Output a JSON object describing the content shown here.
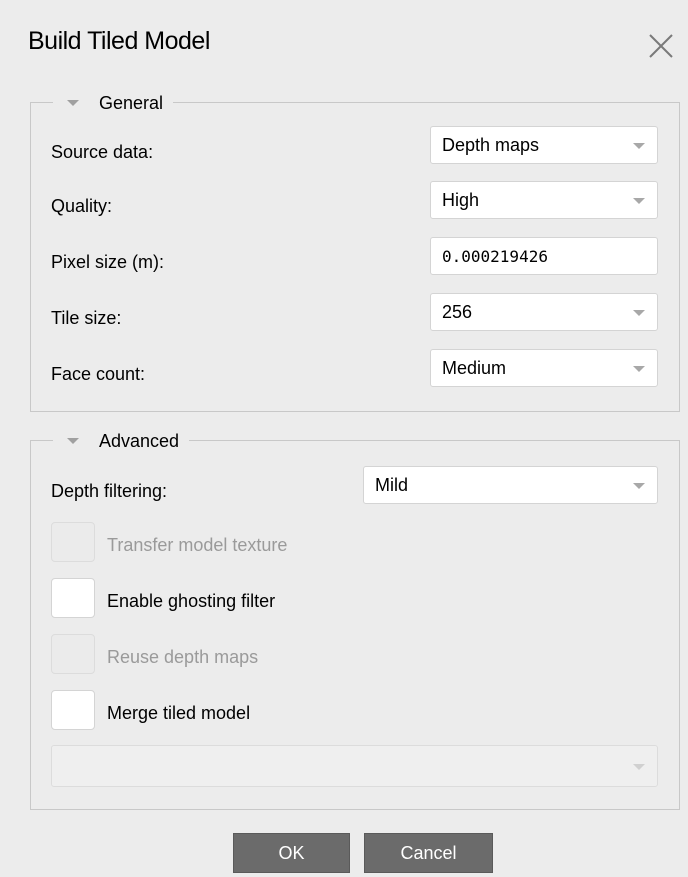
{
  "dialog": {
    "title": "Build Tiled Model"
  },
  "general": {
    "legend": "General",
    "source_data": {
      "label": "Source data:",
      "value": "Depth maps"
    },
    "quality": {
      "label": "Quality:",
      "value": "High"
    },
    "pixel_size": {
      "label": "Pixel size (m):",
      "value": "0.000219426"
    },
    "tile_size": {
      "label": "Tile size:",
      "value": "256"
    },
    "face_count": {
      "label": "Face count:",
      "value": "Medium"
    }
  },
  "advanced": {
    "legend": "Advanced",
    "depth_filtering": {
      "label": "Depth filtering:",
      "value": "Mild"
    },
    "transfer_texture": {
      "label": "Transfer model texture",
      "checked": false,
      "enabled": false
    },
    "ghosting_filter": {
      "label": "Enable ghosting filter",
      "checked": false,
      "enabled": true
    },
    "reuse_depth": {
      "label": "Reuse depth maps",
      "checked": false,
      "enabled": false
    },
    "merge_tiled": {
      "label": "Merge tiled model",
      "checked": false,
      "enabled": true
    },
    "merge_target": {
      "value": ""
    }
  },
  "buttons": {
    "ok": "OK",
    "cancel": "Cancel"
  },
  "icons": {
    "close": "close-icon",
    "collapse": "triangle-down-icon",
    "dropdown": "chevron-down-icon"
  }
}
